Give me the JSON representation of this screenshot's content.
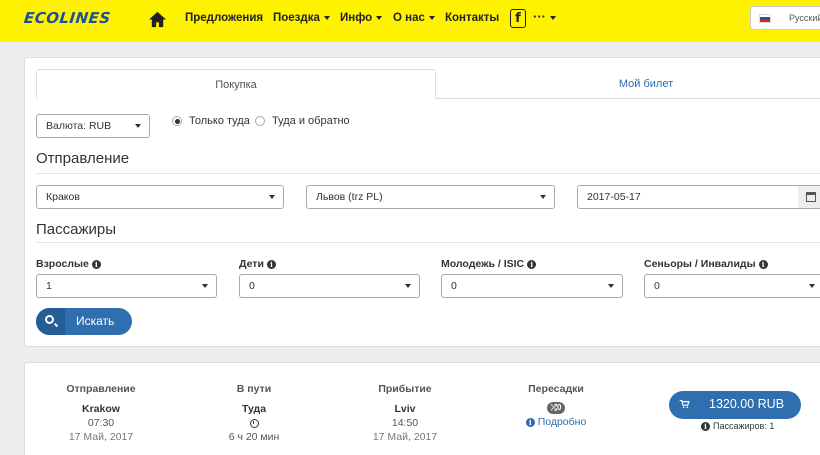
{
  "brand": {
    "logo": "ECOLINES"
  },
  "nav": {
    "offers": "Предложения",
    "trip": "Поездка",
    "info": "Инфо",
    "about": "О нас",
    "contacts": "Контакты",
    "more": "···"
  },
  "language": {
    "label": "Русский"
  },
  "tabs": {
    "purchase": "Покупка",
    "my_ticket": "Мой билет"
  },
  "currency": {
    "value": "Валюта: RUB"
  },
  "trip_type": {
    "one_way": "Только туда",
    "round_trip": "Туда и обратно"
  },
  "departure": {
    "title": "Отправление",
    "from": "Краков",
    "to": "Львов (trz PL)",
    "date": "2017-05-17"
  },
  "passengers": {
    "title": "Пассажиры",
    "adults_label": "Взрослые",
    "adults_value": "1",
    "children_label": "Дети",
    "children_value": "0",
    "youth_label": "Молодежь / ISIC",
    "youth_value": "0",
    "seniors_label": "Сеньоры / Инвалиды",
    "seniors_value": "0"
  },
  "search": {
    "label": "Искать"
  },
  "result": {
    "departure_head": "Отправление",
    "departure_city": "Krakow",
    "departure_time": "07:30",
    "departure_date": "17 Май, 2017",
    "travel_head": "В пути",
    "travel_direction": "Туда",
    "travel_duration": "6 ч 20 мин",
    "arrival_head": "Прибытие",
    "arrival_city": "Lviv",
    "arrival_time": "14:50",
    "arrival_date": "17 Май, 2017",
    "transfers_head": "Пересадки",
    "transfers_count": "0",
    "details_link": "Подробно",
    "price": "1320.00 RUB",
    "pax_count": "Пассажиров: 1"
  },
  "colors": {
    "navbar": "#fff200",
    "accent": "#2f6fb0",
    "logo": "#1a4f9c"
  }
}
